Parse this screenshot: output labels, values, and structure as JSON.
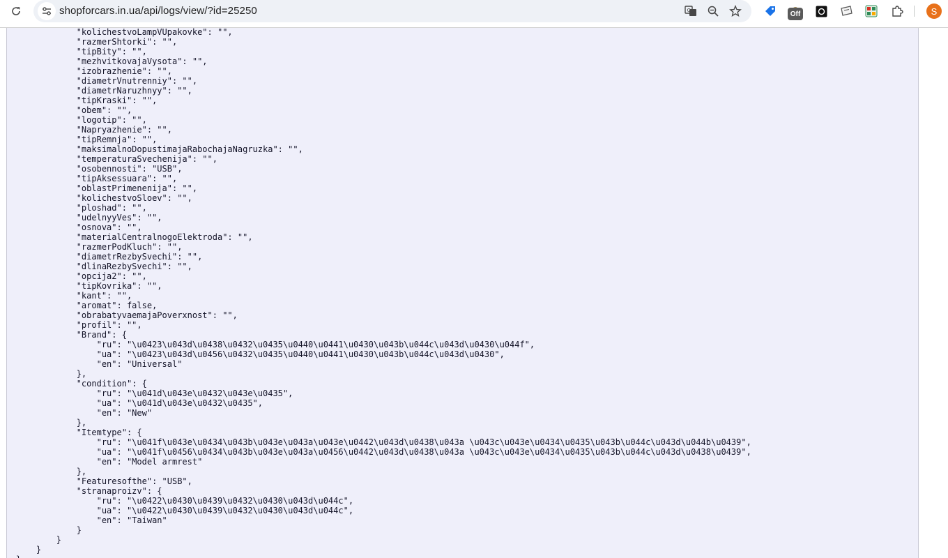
{
  "browser": {
    "url": "shopforcars.in.ua/api/logs/view/?id=25250",
    "icons": {
      "reload": "reload-icon",
      "site_info": "site-info-icon",
      "translate": "translate-icon",
      "zoom": "zoom-icon",
      "bookmark": "star-icon",
      "extensions": "puzzle-icon"
    },
    "extension_off_badge": "Off",
    "profile_initial": "S",
    "accent": "#1a73e8"
  },
  "log_lines": [
    "            \"kolichestvoLampVUpakovke\": \"\",",
    "            \"razmerShtorki\": \"\",",
    "            \"tipBity\": \"\",",
    "            \"mezhvitkovajaVysota\": \"\",",
    "            \"izobrazhenie\": \"\",",
    "            \"diametrVnutrenniy\": \"\",",
    "            \"diametrNaruzhnyy\": \"\",",
    "            \"tipKraski\": \"\",",
    "            \"obem\": \"\",",
    "            \"logotip\": \"\",",
    "            \"Napryazhenie\": \"\",",
    "            \"tipRemnja\": \"\",",
    "            \"maksimalnoDopustimajaRabochajaNagruzka\": \"\",",
    "            \"temperaturaSvechenija\": \"\",",
    "            \"osobennosti\": \"USB\",",
    "            \"tipAksessuara\": \"\",",
    "            \"oblastPrimenenija\": \"\",",
    "            \"kolichestvoSloev\": \"\",",
    "            \"ploshad\": \"\",",
    "            \"udelnyyVes\": \"\",",
    "            \"osnova\": \"\",",
    "            \"materialCentralnogoElektroda\": \"\",",
    "            \"razmerPodKluch\": \"\",",
    "            \"diametrRezbySvechi\": \"\",",
    "            \"dlinaRezbySvechi\": \"\",",
    "            \"opcija2\": \"\",",
    "            \"tipKovrika\": \"\",",
    "            \"kant\": \"\",",
    "            \"aromat\": false,",
    "            \"obrabatyvaemajaPoverxnost\": \"\",",
    "            \"profil\": \"\",",
    "            \"Brand\": {",
    "                \"ru\": \"\\u0423\\u043d\\u0438\\u0432\\u0435\\u0440\\u0441\\u0430\\u043b\\u044c\\u043d\\u0430\\u044f\",",
    "                \"ua\": \"\\u0423\\u043d\\u0456\\u0432\\u0435\\u0440\\u0441\\u0430\\u043b\\u044c\\u043d\\u0430\",",
    "                \"en\": \"Universal\"",
    "            },",
    "            \"condition\": {",
    "                \"ru\": \"\\u041d\\u043e\\u0432\\u043e\\u0435\",",
    "                \"ua\": \"\\u041d\\u043e\\u0432\\u0435\",",
    "                \"en\": \"New\"",
    "            },",
    "            \"Itemtype\": {",
    "                \"ru\": \"\\u041f\\u043e\\u0434\\u043b\\u043e\\u043a\\u043e\\u0442\\u043d\\u0438\\u043a \\u043c\\u043e\\u0434\\u0435\\u043b\\u044c\\u043d\\u044b\\u0439\",",
    "                \"ua\": \"\\u041f\\u0456\\u0434\\u043b\\u043e\\u043a\\u0456\\u0442\\u043d\\u0438\\u043a \\u043c\\u043e\\u0434\\u0435\\u043b\\u044c\\u043d\\u0438\\u0439\",",
    "                \"en\": \"Model armrest\"",
    "            },",
    "            \"Featuresofthe\": \"USB\",",
    "            \"stranaproizv\": {",
    "                \"ru\": \"\\u0422\\u0430\\u0439\\u0432\\u0430\\u043d\\u044c\",",
    "                \"ua\": \"\\u0422\\u0430\\u0439\\u0432\\u0430\\u043d\\u044c\",",
    "                \"en\": \"Taiwan\"",
    "            }",
    "        }",
    "    }",
    "}"
  ]
}
